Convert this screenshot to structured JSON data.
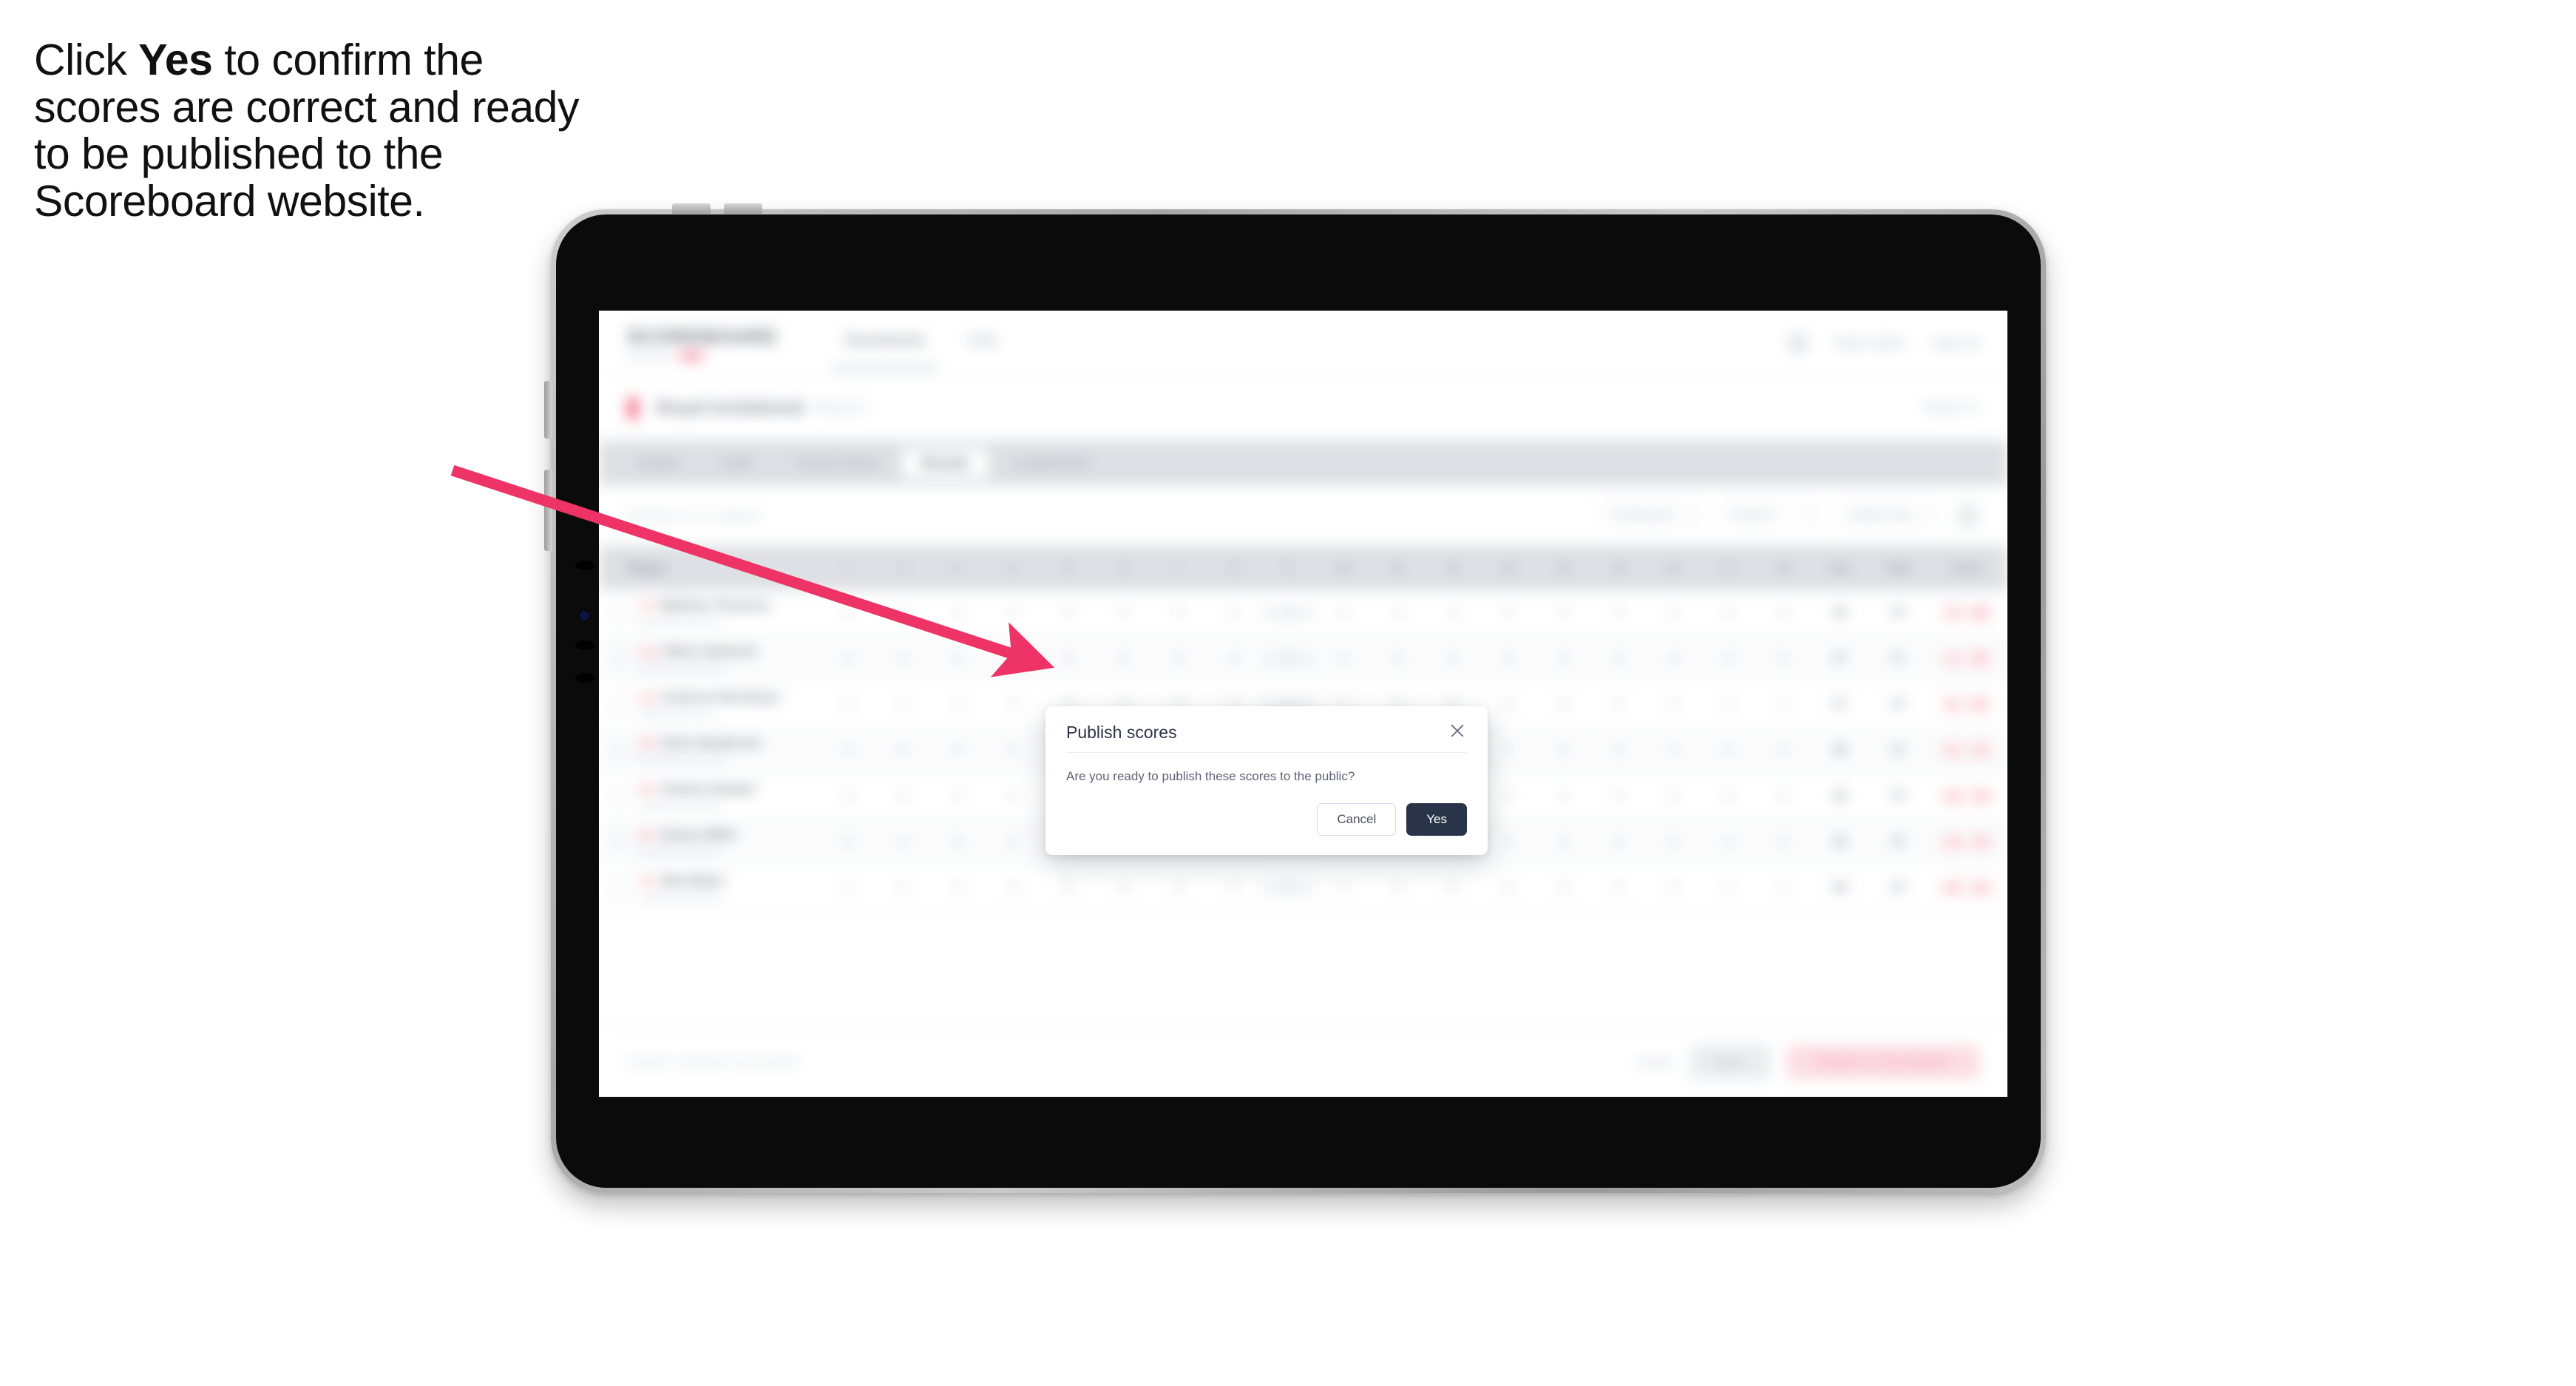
{
  "caption": {
    "part1": "Click ",
    "bold": "Yes",
    "part2": " to confirm the scores are correct and ready to be published to the Scoreboard website."
  },
  "annotation": {
    "arrow_color": "#EE3366",
    "arrow_from": "610,635",
    "arrow_to": "1395,892"
  },
  "device": {
    "type": "tablet",
    "bezel_color": "#0b0b0b",
    "frame_color": "#bdbdbd"
  },
  "app": {
    "header": {
      "logo_main": "SCOREBOARD",
      "logo_sub": "powered by",
      "nav": [
        {
          "label": "Tournaments",
          "active": true
        },
        {
          "label": "Help",
          "active": false
        }
      ],
      "right": {
        "icon": "bell-icon",
        "user_name": "Mark Collins",
        "menu_label": "Sign out"
      }
    },
    "event": {
      "flag_icon": "flag-icon",
      "title": "Royal Invitational",
      "subtitle": "Round 2",
      "right_label": "Week 12"
    },
    "tabs": [
      {
        "label": "Details",
        "active": false
      },
      {
        "label": "Field",
        "active": false
      },
      {
        "label": "Course Setup",
        "active": false
      },
      {
        "label": "Results",
        "active": true
      },
      {
        "label": "Leaderboard",
        "active": false
      }
    ],
    "filters": {
      "left_note": "Showing 7 of 7 players",
      "selects": [
        {
          "label": "All Divisions"
        },
        {
          "label": "Round 2"
        },
        {
          "label": "Stroke Only"
        }
      ],
      "icon": "settings-icon"
    },
    "table": {
      "columns": [
        "Player",
        "1",
        "2",
        "3",
        "4",
        "5",
        "6",
        "7",
        "8",
        "9",
        "10",
        "11",
        "12",
        "13",
        "14",
        "15",
        "16",
        "17",
        "18",
        "Out",
        "Total",
        "Score"
      ],
      "rows": [
        {
          "position": "1st",
          "name": "Matthew Thomson",
          "club": "Riverside Golf Club",
          "holes": [
            "4",
            "5",
            "3",
            "4",
            "4",
            "5",
            "4",
            "3",
            "4",
            "5",
            "4",
            "3",
            "5",
            "4",
            "4",
            "3",
            "4",
            "5"
          ],
          "out": "36",
          "total": "70",
          "score_a": "-2",
          "score_b": "68"
        },
        {
          "position": "2nd",
          "name": "Oliver Harwood",
          "club": "Westwood Golf Club",
          "holes": [
            "4",
            "4",
            "4",
            "3",
            "5",
            "4",
            "5",
            "4",
            "4",
            "4",
            "5",
            "4",
            "4",
            "3",
            "5",
            "4",
            "3",
            "5"
          ],
          "out": "37",
          "total": "71",
          "score_a": "-1",
          "score_b": "69"
        },
        {
          "position": "3rd",
          "name": "Cameron Buchanan",
          "club": "Hillside Golf Club",
          "holes": [
            "5",
            "4",
            "3",
            "4",
            "4",
            "4",
            "4",
            "5",
            "4",
            "3",
            "4",
            "5",
            "4",
            "4",
            "4",
            "5",
            "3",
            "4"
          ],
          "out": "37",
          "total": "72",
          "score_a": "E",
          "score_b": "70"
        },
        {
          "position": "4th",
          "name": "Chris Henderson",
          "club": "Brookfield Golf Club",
          "holes": [
            "4",
            "5",
            "4",
            "4",
            "3",
            "5",
            "4",
            "4",
            "5",
            "4",
            "4",
            "4",
            "3",
            "5",
            "4",
            "4",
            "5",
            "4"
          ],
          "out": "38",
          "total": "73",
          "score_a": "+1",
          "score_b": "71"
        },
        {
          "position": "5th",
          "name": "Andrew Stewart",
          "club": "Parkview Golf Club",
          "holes": [
            "4",
            "4",
            "5",
            "4",
            "4",
            "4",
            "5",
            "4",
            "3",
            "5",
            "4",
            "4",
            "4",
            "4",
            "5",
            "3",
            "4",
            "4"
          ],
          "out": "38",
          "total": "74",
          "score_a": "+2",
          "score_b": "72"
        },
        {
          "position": "6th",
          "name": "Steven Miller",
          "club": "Eastgate Golf Club",
          "holes": [
            "5",
            "4",
            "4",
            "5",
            "4",
            "3",
            "4",
            "5",
            "4",
            "4",
            "5",
            "4",
            "4",
            "4",
            "3",
            "5",
            "4",
            "5"
          ],
          "out": "39",
          "total": "75",
          "score_a": "+3",
          "score_b": "73"
        },
        {
          "position": "7th",
          "name": "Nick Baker",
          "club": "Lakeland Golf Club",
          "holes": [
            "4",
            "5",
            "4",
            "4",
            "5",
            "4",
            "4",
            "4",
            "5",
            "4",
            "4",
            "5",
            "4",
            "3",
            "4",
            "4",
            "5",
            "4"
          ],
          "out": "39",
          "total": "76",
          "score_a": "+4",
          "score_b": "74"
        }
      ]
    },
    "bottom_bar": {
      "note": "Results confirmed successfully",
      "link_label": "Export",
      "secondary_button": "Save",
      "primary_button": "Publish to Scoreboard"
    }
  },
  "modal": {
    "title": "Publish scores",
    "close_icon": "close-icon",
    "message": "Are you ready to publish these scores to the public?",
    "cancel_label": "Cancel",
    "confirm_label": "Yes",
    "confirm_bg": "#2a3448"
  }
}
